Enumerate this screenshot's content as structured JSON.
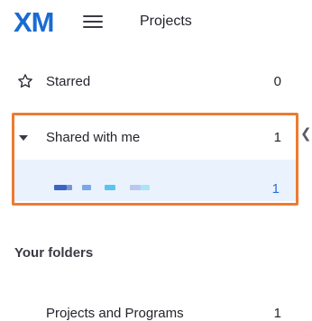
{
  "header": {
    "logo_text": "XM",
    "logo_color": "#1a6bd1",
    "page_title": "Projects"
  },
  "sidebar": {
    "starred": {
      "label": "Starred",
      "count": "0",
      "icon": "star-outline-icon"
    },
    "shared": {
      "label": "Shared with me",
      "count": "1",
      "icon": "caret-down-icon",
      "expanded": true,
      "items": [
        {
          "name_redacted": true,
          "count": "1"
        }
      ]
    },
    "collapse_glyph": "❮",
    "your_folders_heading": "Your folders",
    "folders": [
      {
        "label": "Projects and Programs",
        "count": "1"
      }
    ]
  },
  "colors": {
    "highlight_border": "#ed7b30",
    "selected_row_bg": "#eaf3fd",
    "link_count": "#2b6fd6"
  }
}
